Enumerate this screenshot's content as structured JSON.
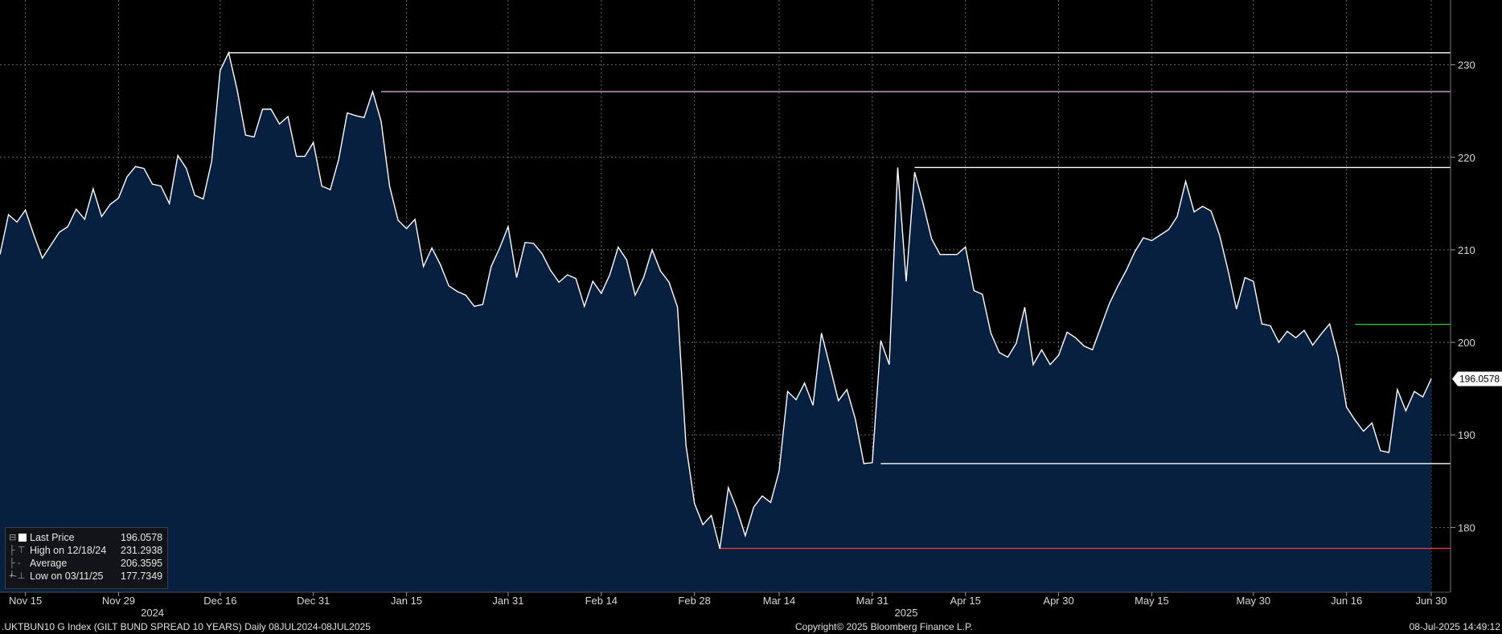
{
  "chart_data": {
    "type": "area",
    "ylim": [
      173,
      237
    ],
    "y_ticks": [
      180,
      190,
      200,
      210,
      220,
      230
    ],
    "x_tick_labels": [
      "Nov 15",
      "Nov 29",
      "Dec 16",
      "Dec 31",
      "Jan 15",
      "Jan 31",
      "Feb 14",
      "Feb 28",
      "Mar 14",
      "Mar 31",
      "Apr 15",
      "Apr 30",
      "May 15",
      "May 30",
      "Jun 16",
      "Jun 30"
    ],
    "year_labels": [
      "2024",
      "2025"
    ],
    "values": [
      209.5,
      213.8,
      213.0,
      214.3,
      211.6,
      209.1,
      210.5,
      211.9,
      212.5,
      214.4,
      213.3,
      216.6,
      213.6,
      214.9,
      215.6,
      217.9,
      219.0,
      218.8,
      217.1,
      216.9,
      215.0,
      220.2,
      218.8,
      215.9,
      215.5,
      219.6,
      229.4,
      231.3,
      227.3,
      222.4,
      222.2,
      225.2,
      225.2,
      223.6,
      224.4,
      220.1,
      220.1,
      221.6,
      216.9,
      216.5,
      219.8,
      224.8,
      224.5,
      224.3,
      227.1,
      223.9,
      216.9,
      213.2,
      212.3,
      213.3,
      208.2,
      210.2,
      208.4,
      206.1,
      205.5,
      205.1,
      203.9,
      204.1,
      208.2,
      210.2,
      212.5,
      207.0,
      210.8,
      210.7,
      209.6,
      207.8,
      206.5,
      207.3,
      206.9,
      203.9,
      206.6,
      205.3,
      207.3,
      210.3,
      208.9,
      205.1,
      207.0,
      210.0,
      207.7,
      206.5,
      203.8,
      188.9,
      182.6,
      180.3,
      181.3,
      177.7,
      184.3,
      182.0,
      179.1,
      182.2,
      183.4,
      182.7,
      186.1,
      194.7,
      193.8,
      195.6,
      193.2,
      201.0,
      197.4,
      193.7,
      194.9,
      191.7,
      186.9,
      187.0,
      200.2,
      197.6,
      218.9,
      206.6,
      218.4,
      215.0,
      211.2,
      209.5,
      209.5,
      209.5,
      210.3,
      205.6,
      205.2,
      201.0,
      198.9,
      198.4,
      199.9,
      203.8,
      197.6,
      199.2,
      197.6,
      198.6,
      201.1,
      200.5,
      199.6,
      199.2,
      201.7,
      204.2,
      206.1,
      207.8,
      209.8,
      211.3,
      211.0,
      211.6,
      212.2,
      213.6,
      217.4,
      214.1,
      214.7,
      214.2,
      211.6,
      207.8,
      203.6,
      207.0,
      206.6,
      202.0,
      201.8,
      200.0,
      201.2,
      200.5,
      201.3,
      199.7,
      200.9,
      202.0,
      198.5,
      193.0,
      191.6,
      190.4,
      191.3,
      188.3,
      188.1,
      194.9,
      192.6,
      194.7,
      194.1,
      196.0578
    ],
    "tick_indices": [
      3,
      14,
      26,
      37,
      48,
      60,
      71,
      82,
      92,
      103,
      114,
      125,
      136,
      148,
      159,
      169
    ],
    "year_indices": [
      18,
      107
    ],
    "reference_lines": [
      {
        "y": 231.2938,
        "from_index": 27,
        "color": "#ffffff"
      },
      {
        "y": 227.1,
        "from_index": 45,
        "color": "#e6b8e6"
      },
      {
        "y": 218.9,
        "from_index": 108,
        "color": "#ffffff"
      },
      {
        "y": 201.95,
        "from_index": 160,
        "color": "#33cc33"
      },
      {
        "y": 186.9,
        "from_index": 104,
        "color": "#ffffff"
      },
      {
        "y": 177.7349,
        "from_index": 85,
        "color": "#ff3b3b"
      }
    ],
    "last_price_tag": "196.0578",
    "series_color": "#ffffff",
    "fill_color": "#07203f"
  },
  "legend": {
    "last_price": {
      "label": "Last Price",
      "value": "196.0578"
    },
    "high": {
      "label": "High on 12/18/24",
      "value": "231.2938"
    },
    "average": {
      "label": "Average",
      "value": "206.3595"
    },
    "low": {
      "label": "Low on 03/11/25",
      "value": "177.7349"
    }
  },
  "footer": {
    "left": ".UKTBUN10 G Index (GILT BUND SPREAD 10 YEARS)  Daily 08JUL2024-08JUL2025",
    "center": "Copyright© 2025 Bloomberg Finance L.P.",
    "right": "08-Jul-2025 14:49:12"
  }
}
